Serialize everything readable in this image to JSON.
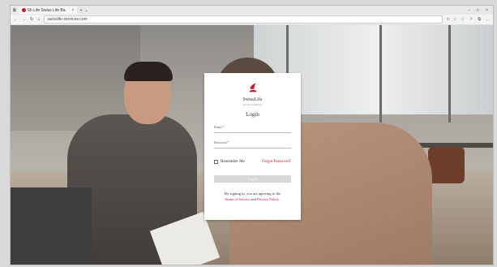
{
  "browser": {
    "tab_title": "Sh Life Swiss Life Ba",
    "tab_close": "×",
    "new_tab": "+",
    "tab_menu": "⌄",
    "window_controls": [
      "−",
      "□",
      "×"
    ],
    "nav": [
      "←",
      "→",
      "↻",
      "⌂"
    ],
    "url": "swisslife-services.com",
    "addr_icons": [
      "□",
      "☆"
    ],
    "toolbar_icons": [
      "☆",
      "⚐",
      "⧉",
      "…"
    ]
  },
  "login": {
    "brand": "SwissLife",
    "tagline": "Global Solutions",
    "title": "Login",
    "email_label": "Email *",
    "password_label": "Password *",
    "remember_label": "Remember Me",
    "forgot_label": "Forgot Password?",
    "button_label": "Log in",
    "terms_prefix": "By signing in, you are agreeing to the",
    "terms_link": "Terms of Service",
    "terms_and": "and",
    "privacy_link": "Privacy Policy",
    "terms_suffix": "."
  },
  "colors": {
    "brand_red": "#d3122d"
  }
}
